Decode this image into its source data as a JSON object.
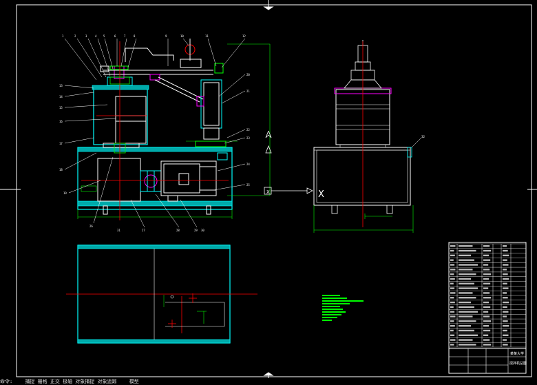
{
  "app": {
    "type": "CAD drawing viewer"
  },
  "colors": {
    "background": "#000000",
    "outline": "#ffffff",
    "cyan": "#00ffff",
    "green": "#00ff00",
    "red": "#ff0000",
    "magenta": "#ff00ff",
    "yellow": "#ffff00"
  },
  "drawing": {
    "front_view_callouts_top": [
      "1",
      "2",
      "3",
      "4",
      "5",
      "6",
      "7",
      "8",
      "9",
      "10",
      "11",
      "12"
    ],
    "front_view_callouts_left": [
      "13",
      "14",
      "15",
      "16",
      "17",
      "18",
      "19"
    ],
    "front_view_callouts_right": [
      "20",
      "21",
      "22",
      "23",
      "24",
      "25"
    ],
    "front_view_callouts_bottom": [
      "26",
      "27",
      "28",
      "29",
      "30",
      "31"
    ],
    "side_view_callout": "32",
    "view_arrow_label": "X",
    "side_view_mark": "X",
    "notes_lines": 6
  },
  "title_block": {
    "school": "某某大学",
    "drawing_name": "搅拌机总图",
    "parts_rows": 22
  },
  "statusbar": {
    "items": [
      "命令:",
      "捕捉 栅格 正交 极轴 对象捕捉 对象追踪",
      "模型"
    ]
  }
}
